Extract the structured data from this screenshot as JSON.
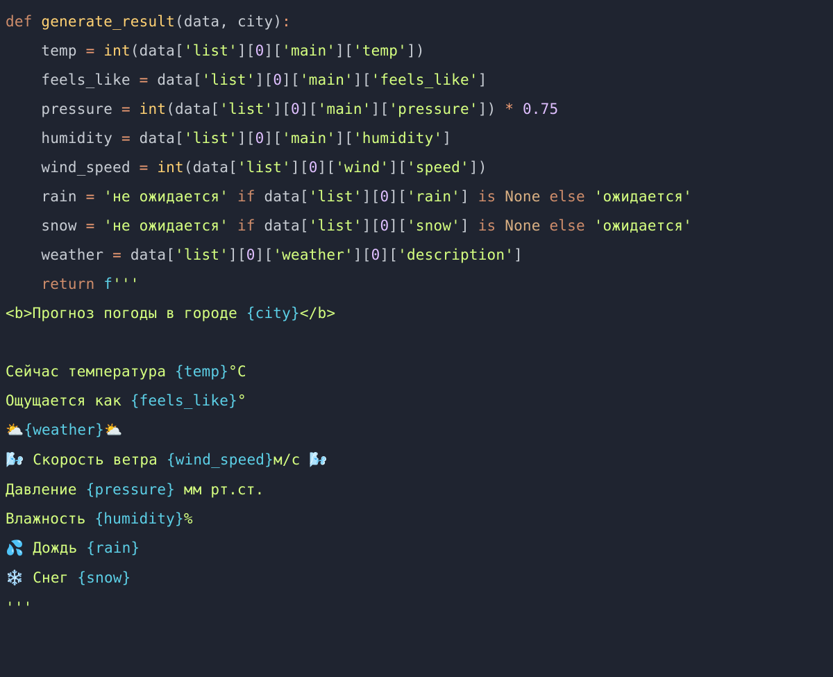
{
  "code": {
    "language": "python",
    "function_name": "generate_result",
    "parameters": [
      "data",
      "city"
    ],
    "lines": [
      {
        "n": 1,
        "kind": "signature",
        "text": "def generate_result(data, city):"
      },
      {
        "n": 2,
        "kind": "assign",
        "var": "temp",
        "expr": "int(data['list'][0]['main']['temp'])"
      },
      {
        "n": 3,
        "kind": "assign",
        "var": "feels_like",
        "expr": "data['list'][0]['main']['feels_like']"
      },
      {
        "n": 4,
        "kind": "assign",
        "var": "pressure",
        "expr": "int(data['list'][0]['main']['pressure']) * 0.75"
      },
      {
        "n": 5,
        "kind": "assign",
        "var": "humidity",
        "expr": "data['list'][0]['main']['humidity']"
      },
      {
        "n": 6,
        "kind": "assign",
        "var": "wind_speed",
        "expr": "int(data['list'][0]['wind']['speed'])"
      },
      {
        "n": 7,
        "kind": "assign",
        "var": "rain",
        "expr": "'не ожидается' if data['list'][0]['rain'] is None else 'ожидается'"
      },
      {
        "n": 8,
        "kind": "assign",
        "var": "snow",
        "expr": "'не ожидается' if data['list'][0]['snow'] is None else 'ожидается'"
      },
      {
        "n": 9,
        "kind": "assign",
        "var": "weather",
        "expr": "data['list'][0]['weather'][0]['description']"
      },
      {
        "n": 10,
        "kind": "return",
        "expr": "f'''"
      },
      {
        "n": 11,
        "kind": "fstring",
        "text": "<b>Прогноз погоды в городе {city}</b>"
      },
      {
        "n": 12,
        "kind": "fstring",
        "text": ""
      },
      {
        "n": 13,
        "kind": "fstring",
        "text": "Сейчас температура {temp}°C"
      },
      {
        "n": 14,
        "kind": "fstring",
        "text": "Ощущается как {feels_like}°"
      },
      {
        "n": 15,
        "kind": "fstring",
        "text": "⛅{weather}⛅"
      },
      {
        "n": 16,
        "kind": "fstring",
        "text": "🌬 Скорость ветра {wind_speed}м/c 🌬"
      },
      {
        "n": 17,
        "kind": "fstring",
        "text": "Давление {pressure} мм рт.ст."
      },
      {
        "n": 18,
        "kind": "fstring",
        "text": "Влажность {humidity}%"
      },
      {
        "n": 19,
        "kind": "fstring",
        "text": "💦 Дождь {rain}"
      },
      {
        "n": 20,
        "kind": "fstring",
        "text": "❄️ Снег {snow}"
      },
      {
        "n": 21,
        "kind": "fstring_end",
        "text": "'''"
      }
    ],
    "string_literals": {
      "not_expected": "не ожидается",
      "expected": "ожидается"
    },
    "subscript_keys": [
      "list",
      "main",
      "temp",
      "feels_like",
      "pressure",
      "humidity",
      "wind",
      "speed",
      "rain",
      "snow",
      "weather",
      "description"
    ],
    "numeric_literals": [
      0,
      0.75
    ],
    "fstring_placeholders": [
      "city",
      "temp",
      "feels_like",
      "weather",
      "wind_speed",
      "pressure",
      "humidity",
      "rain",
      "snow"
    ],
    "emojis": {
      "cloud_sun": "⛅",
      "wind": "🌬",
      "droplets": "💦",
      "snowflake": "❄️"
    }
  },
  "tokens": {
    "def": "def",
    "return": "return",
    "if": "if",
    "is": "is",
    "else": "else",
    "None": "None",
    "int": "int",
    "f_prefix": "f",
    "triple_quote": "'''",
    "op_eq": "=",
    "op_mul": "*",
    "colon": ":",
    "comma": ",",
    "lparen": "(",
    "rparen": ")",
    "lbrack": "[",
    "rbrack": "]",
    "lbrace": "{",
    "rbrace": "}",
    "lt": "<",
    "gt": ">",
    "slash": "/",
    "b": "b",
    "deg": "°",
    "C": "C",
    "pct": "%"
  },
  "vars": {
    "data": "data",
    "city": "city",
    "temp": "temp",
    "feels_like": "feels_like",
    "pressure": "pressure",
    "humidity": "humidity",
    "wind_speed": "wind_speed",
    "rain": "rain",
    "snow": "snow",
    "weather": "weather"
  },
  "keys": {
    "list": "'list'",
    "main": "'main'",
    "temp": "'temp'",
    "feels_like": "'feels_like'",
    "pressure": "'pressure'",
    "humidity": "'humidity'",
    "wind": "'wind'",
    "speed": "'speed'",
    "rain": "'rain'",
    "snow": "'snow'",
    "weather": "'weather'",
    "description": "'description'"
  },
  "nums": {
    "zero": "0",
    "k075": "0.75"
  },
  "strs": {
    "not_expected": "'не ожидается'",
    "expected": "'ожидается'",
    "fs_header_1": "Прогноз погоды в городе ",
    "fs_temp": "Сейчас температура ",
    "fs_feels": "Ощущается как ",
    "fs_wind": " Скорость ветра ",
    "fs_wind_unit": "м/c ",
    "fs_press_1": "Давление ",
    "fs_press_2": " мм рт.ст.",
    "fs_hum": "Влажность ",
    "fs_rain": " Дождь ",
    "fs_snow": " Снег "
  }
}
